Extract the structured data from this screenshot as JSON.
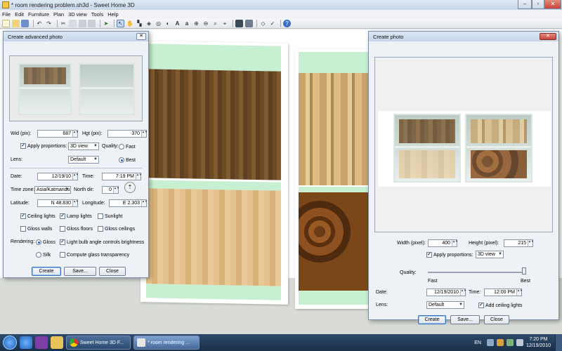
{
  "app": {
    "title": "* room rendering problem.sh3d - Sweet Home 3D",
    "window_controls": [
      "–",
      "▫",
      "✕"
    ]
  },
  "menu": [
    "File",
    "Edit",
    "Furniture",
    "Plan",
    "3D view",
    "Tools",
    "Help"
  ],
  "toolbar_icons": [
    "new-icon",
    "open-icon",
    "save-icon",
    "cut-icon",
    "copy-icon",
    "paste-icon",
    "undo-icon",
    "redo-icon",
    "delete-icon",
    "add-furniture-icon",
    "select-icon",
    "pan-icon",
    "create-walls-icon",
    "create-rooms-icon",
    "create-dimensions-icon",
    "create-labels-icon",
    "zoom-in-icon",
    "zoom-out-icon",
    "text-style-icon",
    "create-photo-icon",
    "create-video-icon",
    "aerial-view-icon",
    "virtual-visit-icon",
    "help-icon"
  ],
  "advanced_photo": {
    "title": "Create advanced photo",
    "width_label": "Wid (pix):",
    "width_value": "687",
    "height_label": "Hgt (pix):",
    "height_value": "370",
    "apply_proportions": "Apply proportions:",
    "proportions_value": "3D view",
    "quality_label": "Quality:",
    "quality_fast": "Fast",
    "quality_best": "Best",
    "lens_label": "Lens:",
    "lens_value": "Default",
    "date_label": "Date:",
    "date_value": "12/19/10",
    "time_label": "Time:",
    "time_value": "7:19 PM",
    "timezone_label": "Time zone:",
    "timezone_value": "Asia/Katmandu",
    "north_label": "North dir:",
    "north_value": "0",
    "latitude_label": "Latitude:",
    "latitude_value": "N 48.830",
    "longitude_label": "Longitude:",
    "longitude_value": "E 2.303",
    "ceiling_lights": "Ceiling lights",
    "lamp_lights": "Lamp lights",
    "sunlight": "Sunlight",
    "gloss_walls": "Gloss walls",
    "gloss_floors": "Gloss floors",
    "gloss_ceilings": "Gloss ceilings",
    "rendering_label": "Rendering:",
    "rendering_gloss": "Gloss",
    "rendering_silk": "Silk",
    "light_bulb": "Light bulb angle controls brightness",
    "glass": "Compute glass transparency",
    "create": "Create",
    "save": "Save...",
    "close": "Close"
  },
  "photo": {
    "title": "Create photo",
    "width_label": "Width (pixel):",
    "width_value": "400",
    "height_label": "Height (pixel):",
    "height_value": "215",
    "apply_proportions": "Apply proportions:",
    "proportions_value": "3D view",
    "quality_label": "Quality:",
    "quality_fast": "Fast",
    "quality_best": "Best",
    "quality_level": 1.0,
    "date_label": "Date:",
    "date_value": "12/19/2010",
    "time_label": "Time:",
    "time_value": "12:00 PM",
    "lens_label": "Lens:",
    "lens_value": "Default",
    "ceiling_lights": "Add ceiling lights",
    "create": "Create",
    "save": "Save...",
    "close": "Close"
  },
  "taskbar": {
    "task1": "Sweet Home 3D F...",
    "task2": "* room rendering ...",
    "lang": "EN",
    "time": "7:20 PM",
    "date": "12/19/2010"
  }
}
